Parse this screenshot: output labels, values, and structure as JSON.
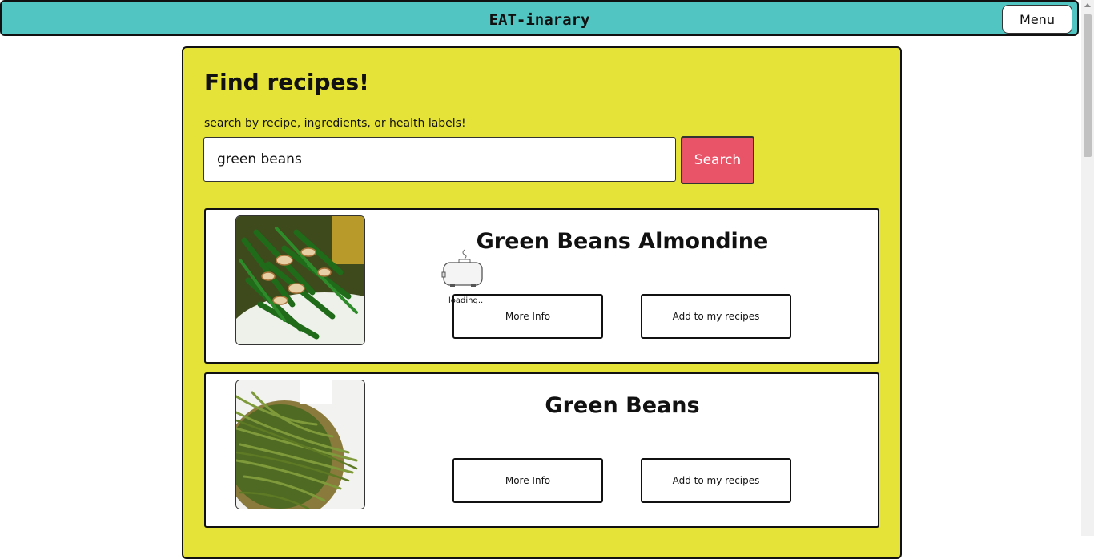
{
  "navbar": {
    "brand": "EAT-inarary",
    "menu_label": "Menu"
  },
  "search": {
    "title": "Find recipes!",
    "hint": "search by recipe, ingredients, or health labels!",
    "value": "green beans",
    "button_label": "Search"
  },
  "results": [
    {
      "title": "Green Beans Almondine",
      "more_info_label": "More Info",
      "add_label": "Add to my recipes"
    },
    {
      "title": "Green Beans",
      "more_info_label": "More Info",
      "add_label": "Add to my recipes"
    }
  ],
  "loader": {
    "text": "loading.."
  },
  "colors": {
    "navbar": "#50c5c1",
    "panel": "#e5e337",
    "search_button": "#ea5469"
  }
}
